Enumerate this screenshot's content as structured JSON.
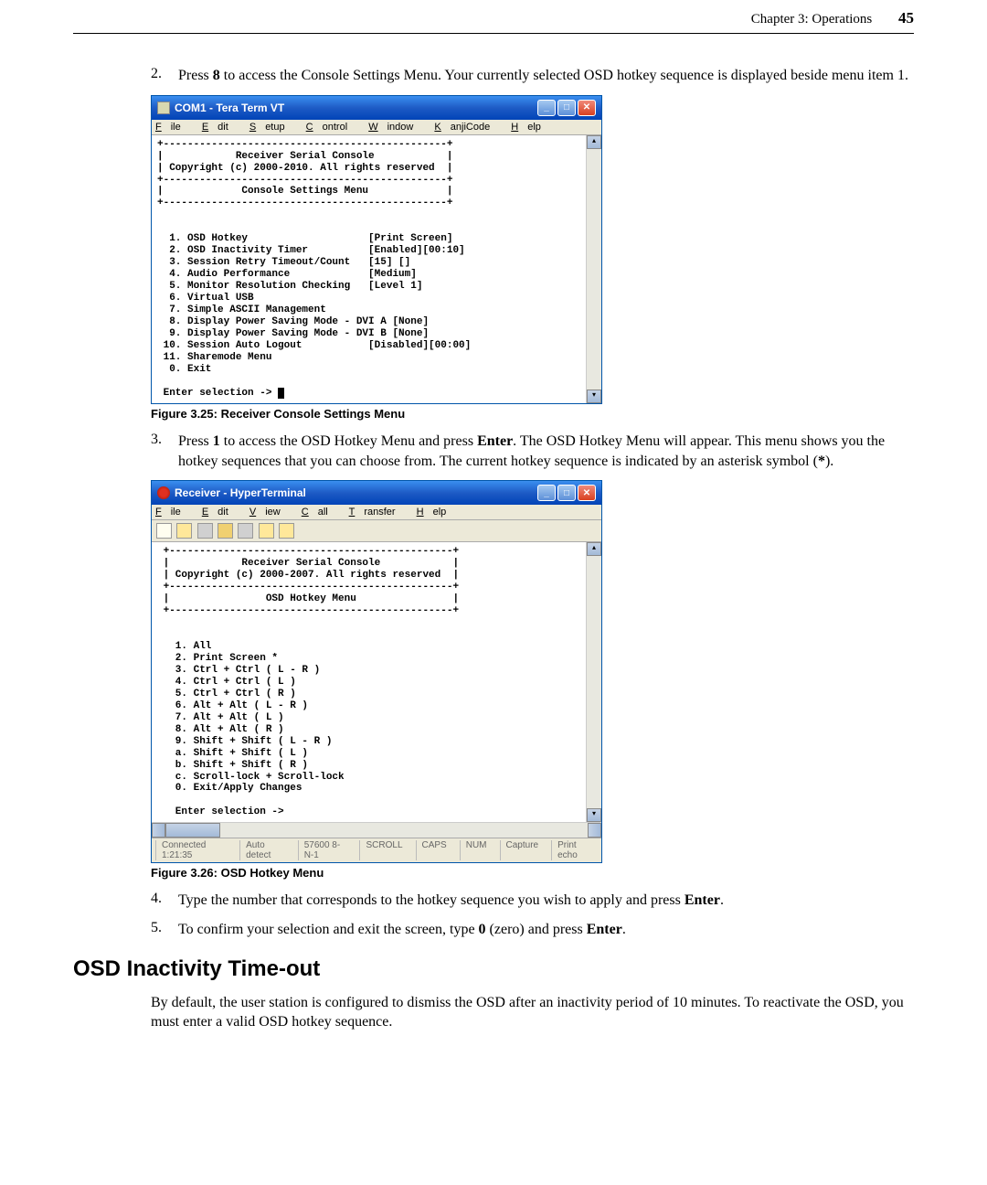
{
  "header": {
    "chapter": "Chapter 3: Operations",
    "page_num": "45"
  },
  "step2": {
    "num": "2.",
    "text_a": "Press ",
    "key": "8",
    "text_b": " to access the Console Settings Menu. Your currently selected OSD hotkey sequence is displayed beside menu item 1."
  },
  "fig325": {
    "title": "COM1 - Tera Term VT",
    "menu": {
      "f": "F",
      "file": "ile",
      "e": "E",
      "edit": "dit",
      "s": "S",
      "setup": "etup",
      "c": "C",
      "ontrol": "ontrol",
      "w": "W",
      "indow": "indow",
      "k": "K",
      "anji": "anjiCode",
      "h": "H",
      "elp": "elp"
    },
    "terminal": "+-----------------------------------------------+\n|            Receiver Serial Console            |\n| Copyright (c) 2000-2010. All rights reserved  |\n+-----------------------------------------------+\n|             Console Settings Menu             |\n+-----------------------------------------------+\n\n\n  1. OSD Hotkey                    [Print Screen]\n  2. OSD Inactivity Timer          [Enabled][00:10]\n  3. Session Retry Timeout/Count   [15] []\n  4. Audio Performance             [Medium]\n  5. Monitor Resolution Checking   [Level 1]\n  6. Virtual USB\n  7. Simple ASCII Management\n  8. Display Power Saving Mode - DVI A [None]\n  9. Display Power Saving Mode - DVI B [None]\n 10. Session Auto Logout           [Disabled][00:00]\n 11. Sharemode Menu\n  0. Exit\n\n Enter selection -> ",
    "caption": "Figure 3.25: Receiver Console Settings Menu"
  },
  "step3": {
    "num": "3.",
    "text_a": "Press ",
    "key1": "1",
    "text_b": " to access the OSD Hotkey Menu and press ",
    "key2": "Enter",
    "text_c": ". The OSD Hotkey Menu will appear. This menu shows you the hotkey sequences that you can choose from. The current hotkey sequence is indicated by an asterisk symbol (",
    "asterisk": "*",
    "text_d": ")."
  },
  "fig326": {
    "title": "Receiver - HyperTerminal",
    "menu": {
      "f": "F",
      "file": "ile",
      "e": "E",
      "edit": "dit",
      "v": "V",
      "iew": "iew",
      "c": "C",
      "all": "all",
      "t": "T",
      "ransfer": "ransfer",
      "h": "H",
      "elp": "elp"
    },
    "terminal": " +-----------------------------------------------+\n |            Receiver Serial Console            |\n | Copyright (c) 2000-2007. All rights reserved  |\n +-----------------------------------------------+\n |                OSD Hotkey Menu                |\n +-----------------------------------------------+\n\n\n   1. All\n   2. Print Screen *\n   3. Ctrl + Ctrl ( L - R )\n   4. Ctrl + Ctrl ( L )\n   5. Ctrl + Ctrl ( R )\n   6. Alt + Alt ( L - R )\n   7. Alt + Alt ( L )\n   8. Alt + Alt ( R )\n   9. Shift + Shift ( L - R )\n   a. Shift + Shift ( L )\n   b. Shift + Shift ( R )\n   c. Scroll-lock + Scroll-lock\n   0. Exit/Apply Changes\n\n   Enter selection ->\n",
    "status": {
      "conn": "Connected 1:21:35",
      "detect": "Auto detect",
      "baud": "57600 8-N-1",
      "scroll": "SCROLL",
      "caps": "CAPS",
      "num": "NUM",
      "capture": "Capture",
      "print": "Print echo"
    },
    "caption": "Figure 3.26: OSD Hotkey Menu"
  },
  "step4": {
    "num": "4.",
    "text_a": "Type the number that corresponds to the hotkey sequence you wish to apply and press ",
    "key": "Enter",
    "text_b": "."
  },
  "step5": {
    "num": "5.",
    "text_a": "To confirm your selection and exit the screen, type ",
    "key": "0",
    "text_b": " (zero) and press ",
    "key2": "Enter",
    "text_c": "."
  },
  "section_heading": "OSD Inactivity Time-out",
  "body1": "By default, the user station is configured to dismiss the OSD after an inactivity period of 10 minutes. To reactivate the OSD, you must enter a valid OSD hotkey sequence."
}
